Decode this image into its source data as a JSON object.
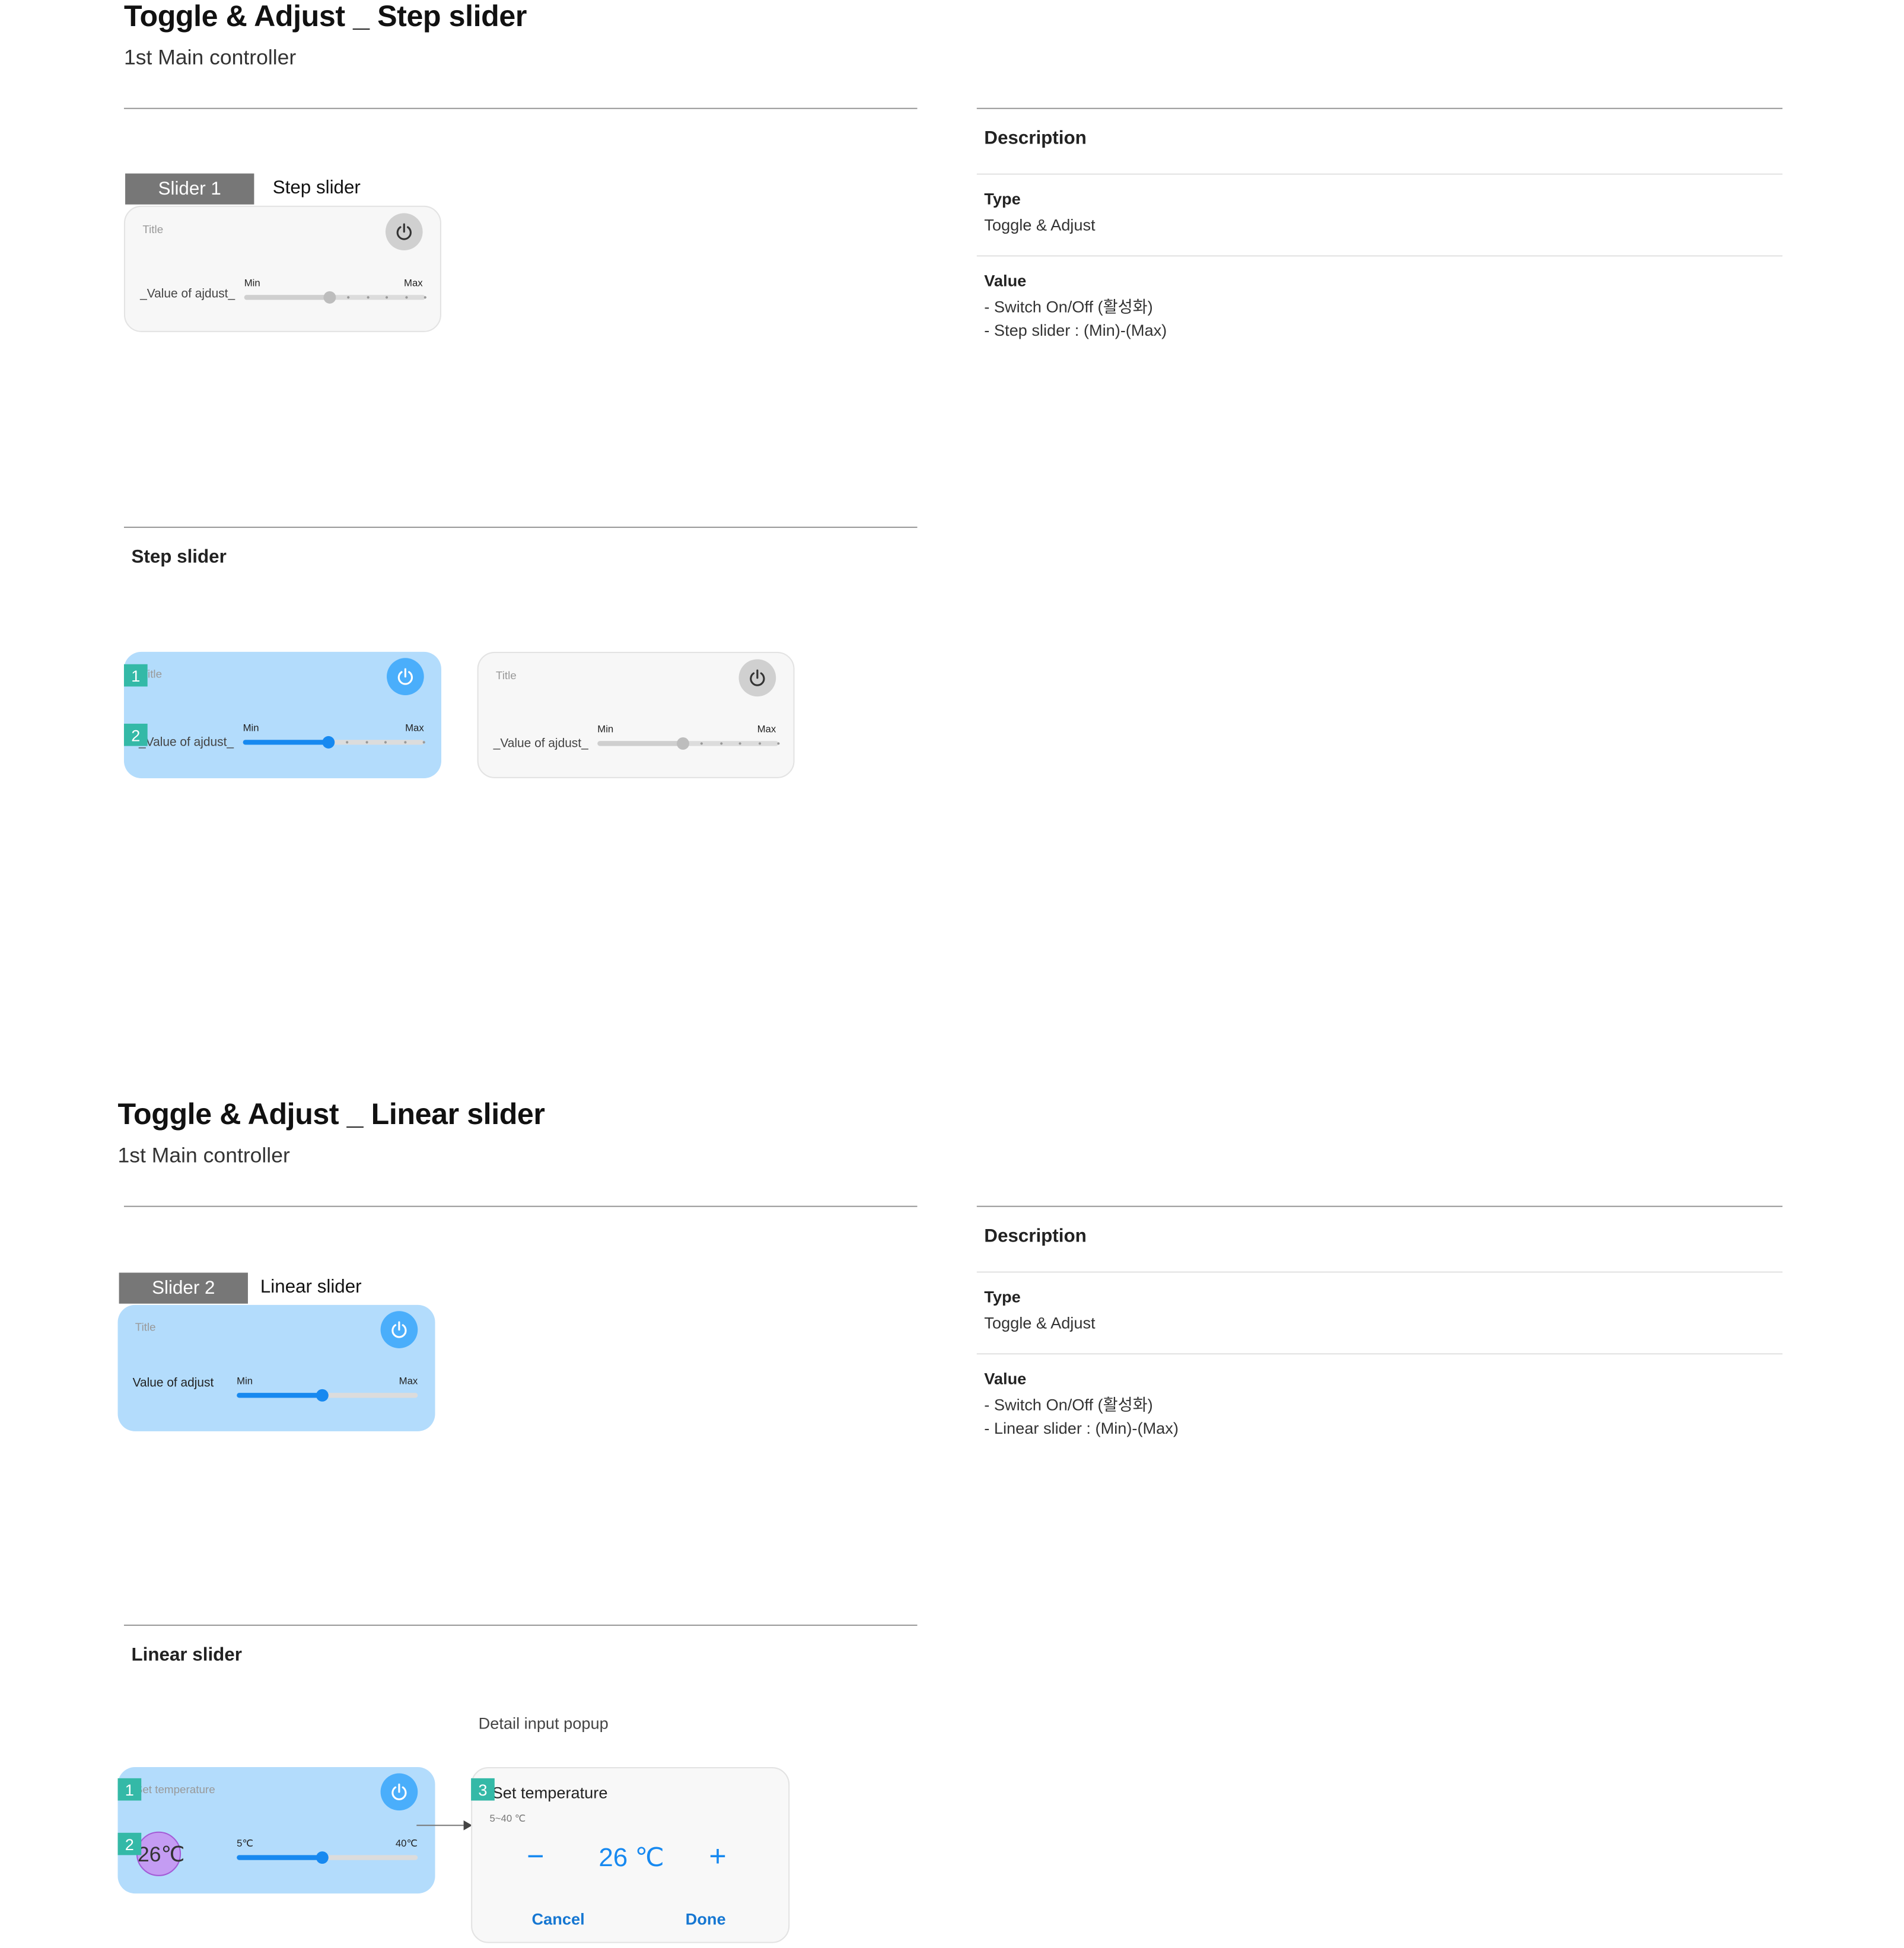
{
  "section1": {
    "title": "Toggle & Adjust _ Step slider",
    "subtitle": "1st Main controller",
    "tag_label": "Slider 1",
    "tag_text": "Step slider",
    "card": {
      "title": "Title",
      "value_label": "_Value of ajdust_",
      "min_label": "Min",
      "max_label": "Max",
      "level": 0.47,
      "steps": 6
    },
    "description": {
      "heading": "Description",
      "type_label": "Type",
      "type_value": "Toggle & Adjust",
      "value_label": "Value",
      "value_lines": [
        "- Switch On/Off (활성화)",
        "- Step slider : (Min)-(Max)"
      ]
    },
    "states_heading": "Step slider",
    "state_on": {
      "title": "Title",
      "value_label": "_Value of ajdust_",
      "min_label": "Min",
      "max_label": "Max",
      "level": 0.47,
      "badge1": "1",
      "badge2": "2"
    },
    "state_off": {
      "title": "Title",
      "value_label": "_Value of ajdust_",
      "min_label": "Min",
      "max_label": "Max",
      "level": 0.47
    }
  },
  "section2": {
    "title": "Toggle & Adjust _ Linear slider",
    "subtitle": "1st Main controller",
    "tag_label": "Slider 2",
    "tag_text": "Linear slider",
    "card": {
      "title": "Title",
      "value_label": "Value of adjust",
      "min_label": "Min",
      "max_label": "Max",
      "level": 0.47
    },
    "description": {
      "heading": "Description",
      "type_label": "Type",
      "type_value": "Toggle & Adjust",
      "value_label": "Value",
      "value_lines": [
        "- Switch On/Off (활성화)",
        "- Linear slider : (Min)-(Max)"
      ]
    },
    "states_heading": "Linear slider",
    "example": {
      "title": "Set temperature",
      "value": "26℃",
      "min_label": "5℃",
      "max_label": "40℃",
      "level": 0.47,
      "badge1": "1",
      "badge2": "2"
    },
    "popup_caption": "Detail input popup",
    "popup": {
      "badge": "3",
      "title": "Set temperature",
      "range": "5~40 ℃",
      "value": "26 ℃",
      "minus": "−",
      "plus": "+",
      "cancel": "Cancel",
      "done": "Done"
    }
  },
  "colors": {
    "active_card": "#b3dcfc",
    "accent": "#1789f0",
    "badge": "#34b9a7",
    "tag": "#777777"
  },
  "icons": [
    "power-icon",
    "arrow-right-icon",
    "minus-icon",
    "plus-icon"
  ]
}
